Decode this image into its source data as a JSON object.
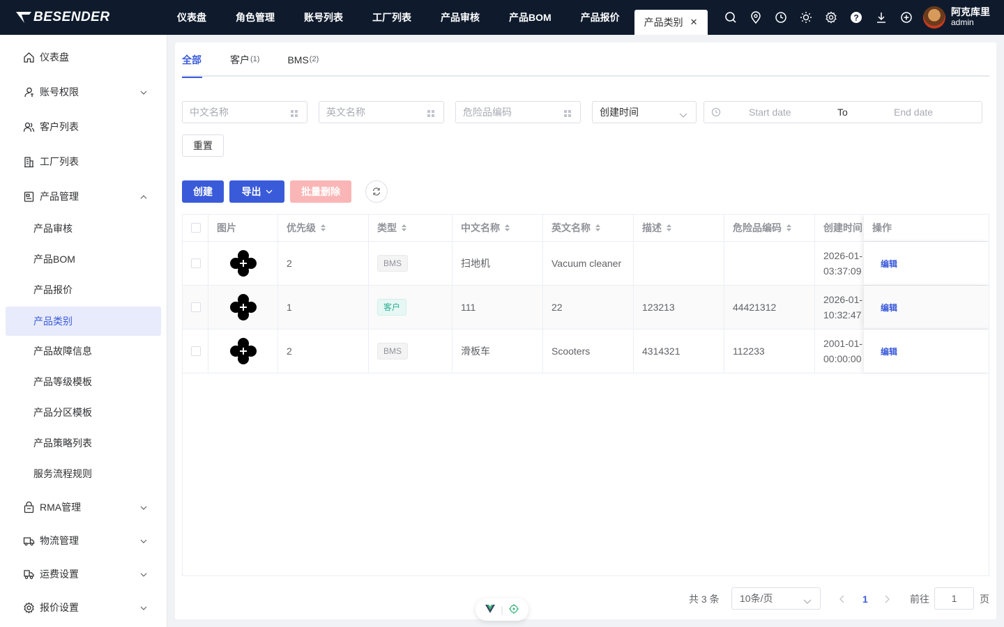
{
  "brand": {
    "name": "BESENDER"
  },
  "topnav": {
    "items": [
      "仪表盘",
      "角色管理",
      "账号列表",
      "工厂列表",
      "产品审核",
      "产品BOM",
      "产品报价"
    ],
    "active": "产品类别"
  },
  "top_icons": [
    "search-icon",
    "location-icon",
    "clock-icon",
    "sun-icon",
    "gear-icon",
    "help-icon",
    "download-icon",
    "add-circle-icon"
  ],
  "user": {
    "name": "阿克库里",
    "role": "admin"
  },
  "sidebar": {
    "dashboard": "仪表盘",
    "account_perm": "账号权限",
    "customers": "客户列表",
    "factories": "工厂列表",
    "product_mgmt": "产品管理",
    "product_sub": [
      "产品审核",
      "产品BOM",
      "产品报价",
      "产品类别",
      "产品故障信息",
      "产品等级模板",
      "产品分区模板",
      "产品策略列表",
      "服务流程规则"
    ],
    "rma": "RMA管理",
    "logistics": "物流管理",
    "freight": "运费设置",
    "quote_settings": "报价设置"
  },
  "tabs": [
    {
      "label": "全部",
      "count": ""
    },
    {
      "label": "客户",
      "count": "(1)"
    },
    {
      "label": "BMS",
      "count": "(2)"
    }
  ],
  "filters": {
    "cn_name_placeholder": "中文名称",
    "en_name_placeholder": "英文名称",
    "dg_code_placeholder": "危险品编码",
    "time_select": "创建时间",
    "start_placeholder": "Start date",
    "range_sep": "To",
    "end_placeholder": "End date",
    "reset_label": "重置"
  },
  "toolbar": {
    "create": "创建",
    "export": "导出",
    "batch_delete": "批量删除"
  },
  "table": {
    "headers": [
      "图片",
      "优先级",
      "类型",
      "中文名称",
      "英文名称",
      "描述",
      "危险品编码",
      "创建时间",
      "操作"
    ],
    "rows": [
      {
        "priority": "2",
        "type": "BMS",
        "cn": "扫地机",
        "en": "Vacuum cleaner",
        "desc": "",
        "code": "",
        "time1": "2026-01-",
        "time2": "03:37:09",
        "op": "编辑"
      },
      {
        "priority": "1",
        "type": "客户",
        "cn": "111",
        "en": "22",
        "desc": "123213",
        "code": "44421312",
        "time1": "2026-01-",
        "time2": "10:32:47",
        "op": "编辑"
      },
      {
        "priority": "2",
        "type": "BMS",
        "cn": "滑板车",
        "en": "Scooters",
        "desc": "4314321",
        "code": "112233",
        "time1": "2001-01-",
        "time2": "00:00:00",
        "op": "编辑"
      }
    ]
  },
  "pagination": {
    "total": "共 3 条",
    "page_size": "10条/页",
    "current": "1",
    "goto": "前往",
    "goto_value": "1",
    "page_unit": "页"
  },
  "colors": {
    "primary": "#3a5bd9",
    "topbar": "#0f1b2d",
    "danger_disabled": "#fab6b6",
    "tag_customer": "#2aae94"
  }
}
